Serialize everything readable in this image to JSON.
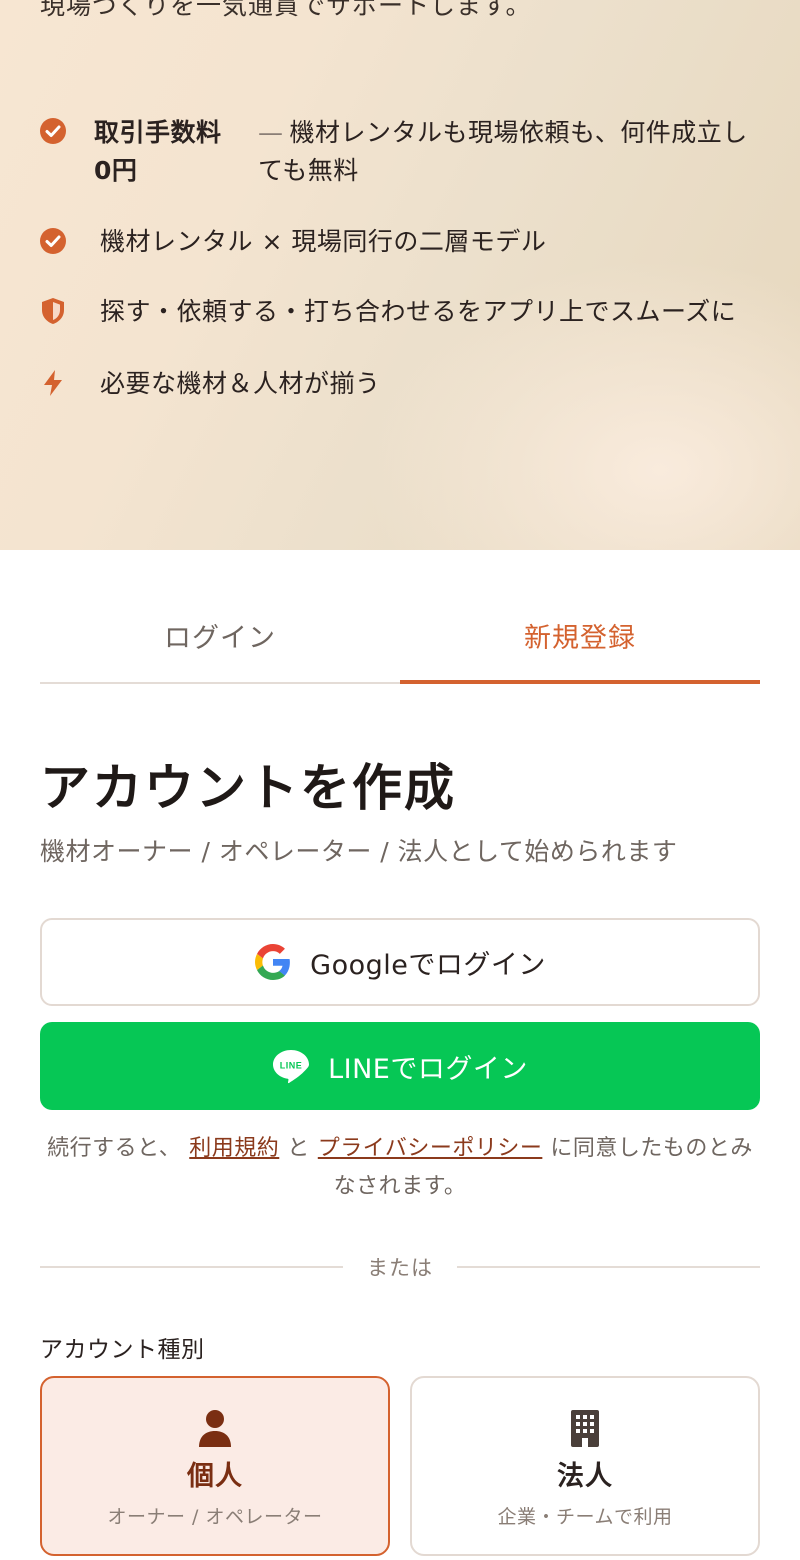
{
  "hero": {
    "subtitle": "現場づくりを一気通貫でサポートします。",
    "features": [
      {
        "icon": "check-circle-icon",
        "title": "取引手数料0円",
        "dash": "—",
        "desc": "機材レンタルも現場依頼も、何件成立しても無料"
      },
      {
        "icon": "check-circle-icon",
        "text": "機材レンタル × 現場同行の二層モデル"
      },
      {
        "icon": "shield-icon",
        "text": "探す・依頼する・打ち合わせるをアプリ上でスムーズに"
      },
      {
        "icon": "lightning-icon",
        "text": "必要な機材＆人材が揃う"
      }
    ]
  },
  "tabs": [
    {
      "label": "ログイン",
      "active": false
    },
    {
      "label": "新規登録",
      "active": true
    }
  ],
  "main": {
    "title": "アカウントを作成",
    "subtitle": "機材オーナー / オペレーター / 法人として始められます"
  },
  "buttons": {
    "google_label": "Googleでログイン",
    "line_label": "LINEでログイン",
    "line_icon_text": "LINE"
  },
  "terms": {
    "prefix": "続行すると、",
    "terms_link": "利用規約",
    "conjunction": "と",
    "privacy_link": "プライバシーポリシー",
    "suffix": "に同意したものとみなされます。"
  },
  "divider": {
    "label": "または"
  },
  "account_type": {
    "label": "アカウント種別",
    "options": [
      {
        "icon": "person-icon",
        "title": "個人",
        "subtitle": "オーナー / オペレーター",
        "selected": true
      },
      {
        "icon": "building-icon",
        "title": "法人",
        "subtitle": "企業・チームで利用",
        "selected": false
      }
    ]
  },
  "colors": {
    "accent": "#d4622f",
    "line_green": "#06c755",
    "selected_bg": "#fbebe5"
  }
}
